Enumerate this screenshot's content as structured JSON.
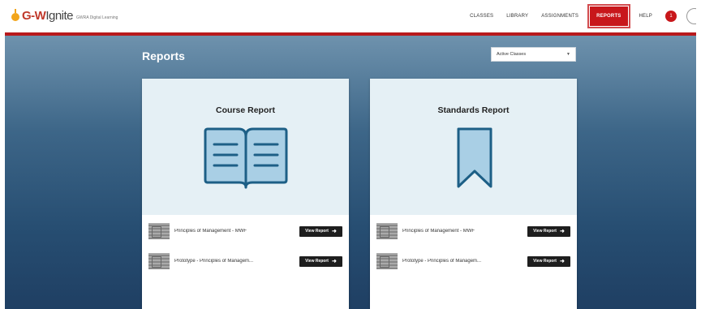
{
  "brand": {
    "logo_text_gw": "G-W",
    "logo_text_ignite": "Ignite",
    "tagline": "GWRA Digital Learning"
  },
  "nav": {
    "items": [
      {
        "label": "CLASSES"
      },
      {
        "label": "LIBRARY"
      },
      {
        "label": "ASSIGNMENTS"
      },
      {
        "label": "REPORTS",
        "active": true
      },
      {
        "label": "HELP"
      }
    ],
    "notification_count": "1"
  },
  "page": {
    "title": "Reports",
    "filter": {
      "selected": "Active Classes"
    }
  },
  "cards": [
    {
      "title": "Course Report",
      "icon": "open-book-icon",
      "rows": [
        {
          "label": "Principles of Management - MWF",
          "button": "View Report"
        },
        {
          "label": "Prototype - Principles of Managem...",
          "button": "View Report"
        }
      ]
    },
    {
      "title": "Standards Report",
      "icon": "bookmark-ribbon-icon",
      "rows": [
        {
          "label": "Principles of Management - MWF",
          "button": "View Report"
        },
        {
          "label": "Prototype - Principles of Managem...",
          "button": "View Report"
        }
      ]
    }
  ],
  "colors": {
    "accent_red": "#c8171b",
    "icon_blue": "#1d5f86",
    "card_top_bg": "#e5f0f5",
    "bg_gradient_top": "#6e92ad",
    "bg_gradient_bottom": "#1f3f63"
  }
}
